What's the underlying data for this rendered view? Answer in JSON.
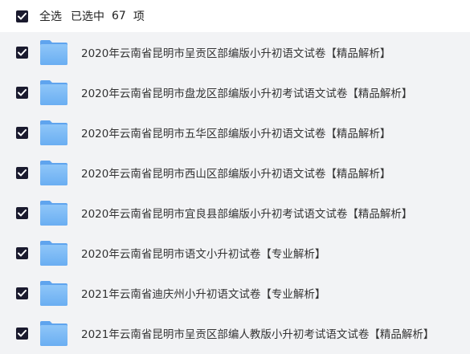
{
  "header": {
    "select_all_label": "全选",
    "selected_text": "已选中",
    "selected_count": "67",
    "selected_unit": "项"
  },
  "files": [
    {
      "name": "2020年云南省昆明市呈贡区部编版小升初语文试卷【精品解析】",
      "checked": true
    },
    {
      "name": "2020年云南省昆明市盘龙区部编版小升初考试语文试卷【精品解析】",
      "checked": true
    },
    {
      "name": "2020年云南省昆明市五华区部编版小升初语文试卷【精品解析】",
      "checked": true
    },
    {
      "name": "2020年云南省昆明市西山区部编版小升初语文试卷【精品解析】",
      "checked": true
    },
    {
      "name": "2020年云南省昆明市宜良县部编版小升初考试语文试卷【精品解析】",
      "checked": true
    },
    {
      "name": "2020年云南省昆明市语文小升初试卷【专业解析】",
      "checked": true
    },
    {
      "name": "2021年云南省迪庆州小升初语文试卷【专业解析】",
      "checked": true
    },
    {
      "name": "2021年云南省昆明市呈贡区部编人教版小升初考试语文试卷【精品解析】",
      "checked": true
    }
  ],
  "icons": {
    "checkbox": "checkmark-icon",
    "file": "folder-icon"
  },
  "colors": {
    "checkbox_bg": "#1a1a2e",
    "folder": "#7ab8f5",
    "list_bg": "#f2f3f5"
  }
}
